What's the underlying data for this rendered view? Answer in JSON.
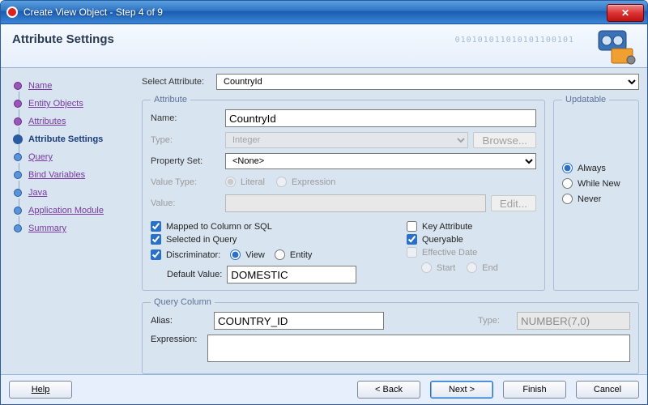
{
  "window": {
    "title": "Create View Object - Step 4 of 9"
  },
  "header": {
    "title": "Attribute Settings"
  },
  "steps": {
    "items": [
      {
        "label": "Name",
        "state": "past"
      },
      {
        "label": "Entity Objects",
        "state": "past"
      },
      {
        "label": "Attributes",
        "state": "past"
      },
      {
        "label": "Attribute Settings",
        "state": "current"
      },
      {
        "label": "Query",
        "state": "future"
      },
      {
        "label": "Bind Variables",
        "state": "future"
      },
      {
        "label": "Application Module",
        "state": "future"
      },
      {
        "label": "Java",
        "state": "future"
      },
      {
        "label": "Summary",
        "state": "future"
      }
    ]
  },
  "labels": {
    "select_attribute": "Select Attribute:",
    "attribute_legend": "Attribute",
    "updatable_legend": "Updatable",
    "query_column_legend": "Query Column",
    "name": "Name:",
    "type": "Type:",
    "property_set": "Property Set:",
    "value_type": "Value Type:",
    "value": "Value:",
    "browse": "Browse...",
    "edit": "Edit...",
    "literal": "Literal",
    "expression": "Expression",
    "mapped": "Mapped to Column or SQL",
    "selected_in_query": "Selected in Query",
    "discriminator": "Discriminator:",
    "view": "View",
    "entity": "Entity",
    "default_value": "Default Value:",
    "key_attribute": "Key Attribute",
    "queryable": "Queryable",
    "effective_date": "Effective Date",
    "start": "Start",
    "end": "End",
    "always": "Always",
    "while_new": "While New",
    "never": "Never",
    "alias": "Alias:",
    "q_type": "Type:",
    "q_expression": "Expression:"
  },
  "values": {
    "selected_attribute": "CountryId",
    "name": "CountryId",
    "type": "Integer",
    "property_set": "<None>",
    "value": "",
    "default_value": "DOMESTIC",
    "alias": "COUNTRY_ID",
    "q_type": "NUMBER(7,0)",
    "expression": ""
  },
  "state": {
    "value_type": "literal",
    "mapped": true,
    "selected_in_query": true,
    "discriminator": true,
    "discriminator_scope": "view",
    "key_attribute": false,
    "queryable": true,
    "effective_date": false,
    "effective_choice": null,
    "updatable": "always"
  },
  "footer": {
    "help": "Help",
    "back": "< Back",
    "next": "Next >",
    "finish": "Finish",
    "cancel": "Cancel"
  }
}
